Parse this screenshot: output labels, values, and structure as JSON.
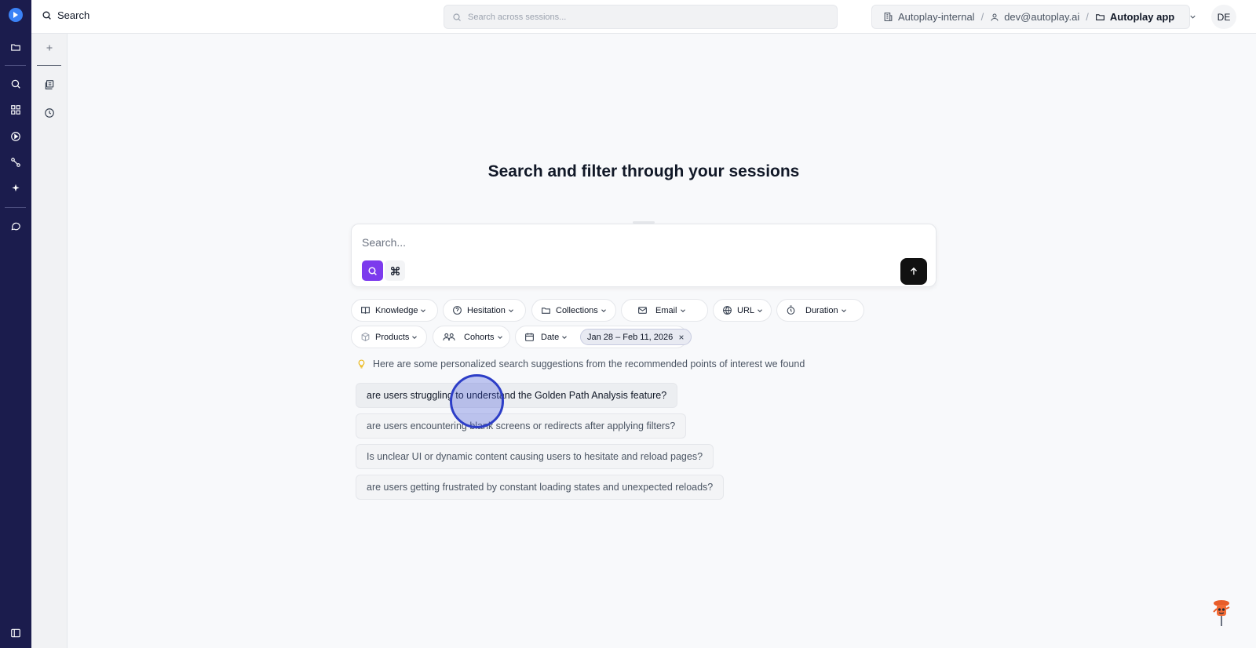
{
  "topbar": {
    "title": "Search",
    "global_search_placeholder": "Search across sessions...",
    "breadcrumb": {
      "org": "Autoplay-internal",
      "user": "dev@autoplay.ai",
      "project": "Autoplay app"
    },
    "avatar_initials": "DE"
  },
  "main": {
    "headline": "Search and filter through your sessions",
    "search_placeholder": "Search...",
    "filters": [
      {
        "label": "Knowledge",
        "icon": "book-icon"
      },
      {
        "label": "Hesitation",
        "icon": "help-circle-icon"
      },
      {
        "label": "Collections",
        "icon": "folder-icon"
      },
      {
        "label": "Email",
        "icon": "mail-icon"
      },
      {
        "label": "URL",
        "icon": "globe-icon"
      },
      {
        "label": "Duration",
        "icon": "timer-icon"
      },
      {
        "label": "Products",
        "icon": "box-icon"
      },
      {
        "label": "Cohorts",
        "icon": "users-icon"
      },
      {
        "label": "Date",
        "icon": "calendar-icon"
      }
    ],
    "date_range": "Jan 28 – Feb 11, 2026",
    "suggestions_hint": "Here are some personalized search suggestions from the recommended points of interest we found",
    "suggestions": [
      "are users struggling to understand the Golden Path Analysis feature?",
      "are users encountering blank screens or redirects after applying filters?",
      "Is unclear UI or dynamic content causing users to hesitate and reload pages?",
      "are users getting frustrated by constant loading states and unexpected reloads?"
    ]
  },
  "colors": {
    "rail": "#1b1c4d",
    "accent": "#7c3aed",
    "submit": "#111111",
    "brand": "#3b82f6"
  }
}
